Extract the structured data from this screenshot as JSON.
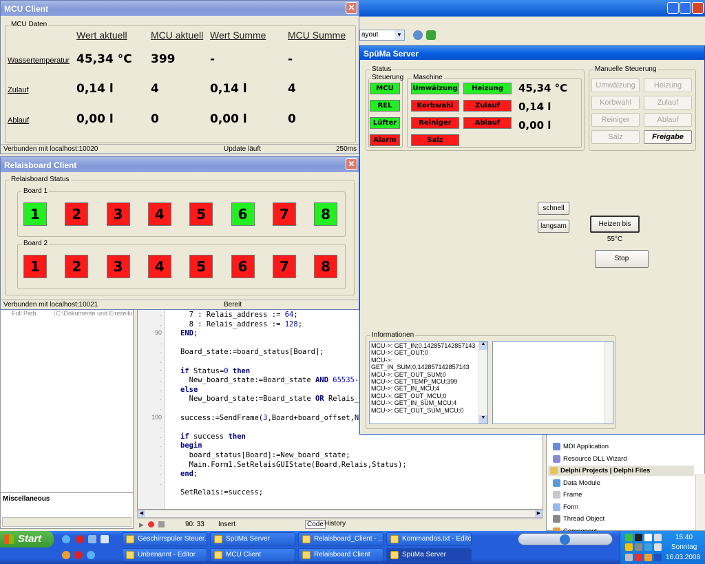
{
  "mcu_client": {
    "title": "MCU Client",
    "group_label": "MCU Daten",
    "columns": [
      "Wert aktuell",
      "MCU aktuell",
      "Wert Summe",
      "MCU Summe"
    ],
    "rows": [
      {
        "label": "Wassertemperatur",
        "values": [
          "45,34 °C",
          "399",
          "-",
          "-"
        ]
      },
      {
        "label": "Zulauf",
        "values": [
          "0,14 l",
          "4",
          "0,14 l",
          "4"
        ]
      },
      {
        "label": "Ablauf",
        "values": [
          "0,00 l",
          "0",
          "0,00 l",
          "0"
        ]
      }
    ],
    "status": {
      "connection": "Verbunden mit localhost:10020",
      "update": "Update läuft",
      "interval": "250ms"
    }
  },
  "relais_client": {
    "title": "Relaisboard Client",
    "group_label": "Relaisboard Status",
    "boards": [
      {
        "label": "Board 1",
        "relais": [
          {
            "n": "1",
            "on": true
          },
          {
            "n": "2",
            "on": false
          },
          {
            "n": "3",
            "on": false
          },
          {
            "n": "4",
            "on": false
          },
          {
            "n": "5",
            "on": false
          },
          {
            "n": "6",
            "on": true
          },
          {
            "n": "7",
            "on": false
          },
          {
            "n": "8",
            "on": true
          }
        ]
      },
      {
        "label": "Board 2",
        "relais": [
          {
            "n": "1",
            "on": false
          },
          {
            "n": "2",
            "on": false
          },
          {
            "n": "3",
            "on": false
          },
          {
            "n": "4",
            "on": false
          },
          {
            "n": "5",
            "on": false
          },
          {
            "n": "6",
            "on": false
          },
          {
            "n": "7",
            "on": false
          },
          {
            "n": "8",
            "on": false
          }
        ]
      }
    ],
    "status": {
      "connection": "Verbunden mit localhost:10021",
      "state": "Bereit"
    }
  },
  "server": {
    "title": "SpüMa Server",
    "status_label": "Status",
    "steuerung_label": "Steuerung",
    "maschine_label": "Maschine",
    "manuell_label": "Manuelle Steuerung",
    "steuerung": [
      {
        "label": "MCU",
        "state": "green"
      },
      {
        "label": "REL",
        "state": "green"
      },
      {
        "label": "Lüfter",
        "state": "green"
      },
      {
        "label": "Alarm",
        "state": "red"
      }
    ],
    "maschine_col1": [
      {
        "label": "Umwälzung",
        "state": "green"
      },
      {
        "label": "Korbwahl",
        "state": "red"
      },
      {
        "label": "Reiniger",
        "state": "red"
      },
      {
        "label": "Salz",
        "state": "red"
      }
    ],
    "maschine_col2": [
      {
        "label": "Heizung",
        "state": "green"
      },
      {
        "label": "Zulauf",
        "state": "red"
      },
      {
        "label": "Ablauf",
        "state": "red"
      }
    ],
    "values": [
      "45,34 °C",
      "0,14 l",
      "0,00 l"
    ],
    "manual_buttons": [
      [
        "Umwälzung",
        "Heizung"
      ],
      [
        "Korbwahl",
        "Zulauf"
      ],
      [
        "Reiniger",
        "Ablauf"
      ],
      [
        "Salz",
        "Freigabe"
      ]
    ],
    "btn_schnell": "schnell",
    "btn_langsam": "langsam",
    "btn_heizen": "Heizen bis 55°C",
    "btn_stop": "Stop",
    "info_label": "Informationen",
    "log": [
      "MCU->: GET_IN;0,142857142857143",
      "MCU->: GET_OUT;0",
      "MCU->:",
      "GET_IN_SUM;0,142857142857143",
      "MCU->: GET_OUT_SUM;0",
      "MCU->: GET_TEMP_MCU;399",
      "MCU->: GET_IN_MCU;4",
      "MCU->: GET_OUT_MCU;0",
      "MCU->: GET_IN_SUM_MCU;4",
      "MCU->: GET_OUT_SUM_MCU;0"
    ]
  },
  "ide": {
    "layout_combo": "ayout",
    "left_panel": {
      "prop_name": "Full Path",
      "prop_value": "C:\\Dokumente und Einstellu",
      "section": "Miscellaneous"
    },
    "gutter": [
      ".",
      ".",
      "90",
      ".",
      ".",
      ".",
      "-",
      ".",
      ".",
      ".",
      ".",
      "100",
      ".",
      ".",
      ".",
      ".",
      ".",
      ".",
      "."
    ],
    "code_lines": [
      [
        {
          "t": "  7 : Relais_address := ",
          "c": ""
        },
        {
          "t": "64",
          "c": "num"
        },
        {
          "t": ";",
          "c": ""
        }
      ],
      [
        {
          "t": "  8 : Relais_address := ",
          "c": ""
        },
        {
          "t": "128",
          "c": "num"
        },
        {
          "t": ";",
          "c": ""
        }
      ],
      [
        {
          "t": "END",
          "c": "kw"
        },
        {
          "t": ";",
          "c": ""
        }
      ],
      [
        {
          "t": "",
          "c": ""
        }
      ],
      [
        {
          "t": "Board_state:=board_status[Board];",
          "c": ""
        }
      ],
      [
        {
          "t": "",
          "c": ""
        }
      ],
      [
        {
          "t": "if",
          "c": "kw"
        },
        {
          "t": " Status=",
          "c": ""
        },
        {
          "t": "0",
          "c": "num"
        },
        {
          "t": " ",
          "c": ""
        },
        {
          "t": "then",
          "c": "kw"
        }
      ],
      [
        {
          "t": "  New_board_state:=Board_state ",
          "c": ""
        },
        {
          "t": "AND",
          "c": "kw"
        },
        {
          "t": " ",
          "c": ""
        },
        {
          "t": "65535",
          "c": "num"
        },
        {
          "t": "-",
          "c": ""
        }
      ],
      [
        {
          "t": "else",
          "c": "kw"
        }
      ],
      [
        {
          "t": "  New_board_state:=Board_state ",
          "c": ""
        },
        {
          "t": "OR",
          "c": "kw"
        },
        {
          "t": " Relais_",
          "c": ""
        }
      ],
      [
        {
          "t": "",
          "c": ""
        }
      ],
      [
        {
          "t": "success:=SendFrame(",
          "c": ""
        },
        {
          "t": "3",
          "c": "num"
        },
        {
          "t": ",Board+board_offset,N",
          "c": ""
        }
      ],
      [
        {
          "t": "",
          "c": ""
        }
      ],
      [
        {
          "t": "if",
          "c": "kw"
        },
        {
          "t": " success ",
          "c": ""
        },
        {
          "t": "then",
          "c": "kw"
        }
      ],
      [
        {
          "t": "begin",
          "c": "kw"
        }
      ],
      [
        {
          "t": "  board_status[Board]:=New_board_state;",
          "c": ""
        }
      ],
      [
        {
          "t": "  Main.Form1.SetRelaisGUIState(Board,Relais,Status);",
          "c": ""
        }
      ],
      [
        {
          "t": "end",
          "c": "kw"
        },
        {
          "t": ";",
          "c": ""
        }
      ],
      [
        {
          "t": "",
          "c": ""
        }
      ],
      [
        {
          "t": "SetRelais:=success;",
          "c": ""
        }
      ]
    ],
    "status": {
      "pos": "90:  33",
      "mode": "Insert",
      "tabs": [
        "Code",
        "History"
      ]
    },
    "repo_items": [
      {
        "icon": "app",
        "label": "MDI Application",
        "header": false
      },
      {
        "icon": "dll",
        "label": "Resource DLL Wizard",
        "header": false
      },
      {
        "icon": "folder",
        "label": "Delphi Projects | Delphi Files",
        "header": true
      },
      {
        "icon": "module",
        "label": "Data Module",
        "header": false
      },
      {
        "icon": "frame",
        "label": "Frame",
        "header": false
      },
      {
        "icon": "form",
        "label": "Form",
        "header": false
      },
      {
        "icon": "thread",
        "label": "Thread Object",
        "header": false
      },
      {
        "icon": "component",
        "label": "Component",
        "header": false
      }
    ]
  },
  "taskbar": {
    "start": "Start",
    "row1": [
      "Geschirrspüler Steuer...",
      "SpüMa Server",
      "Relaisboard_Client - ...",
      "Kommandos.txt - Editor"
    ],
    "row2": [
      "Unbenannt - Editor",
      "MCU Client",
      "Relaisboard Client",
      "SpüMa Server"
    ],
    "clock": {
      "time": "15:40",
      "day": "Sonntag",
      "date": "16.03.2008"
    }
  },
  "colors": {
    "on": "#22ee22",
    "off": "#ff1a1a",
    "title_active": "#0a5fe0",
    "taskbar": "#245edb"
  }
}
